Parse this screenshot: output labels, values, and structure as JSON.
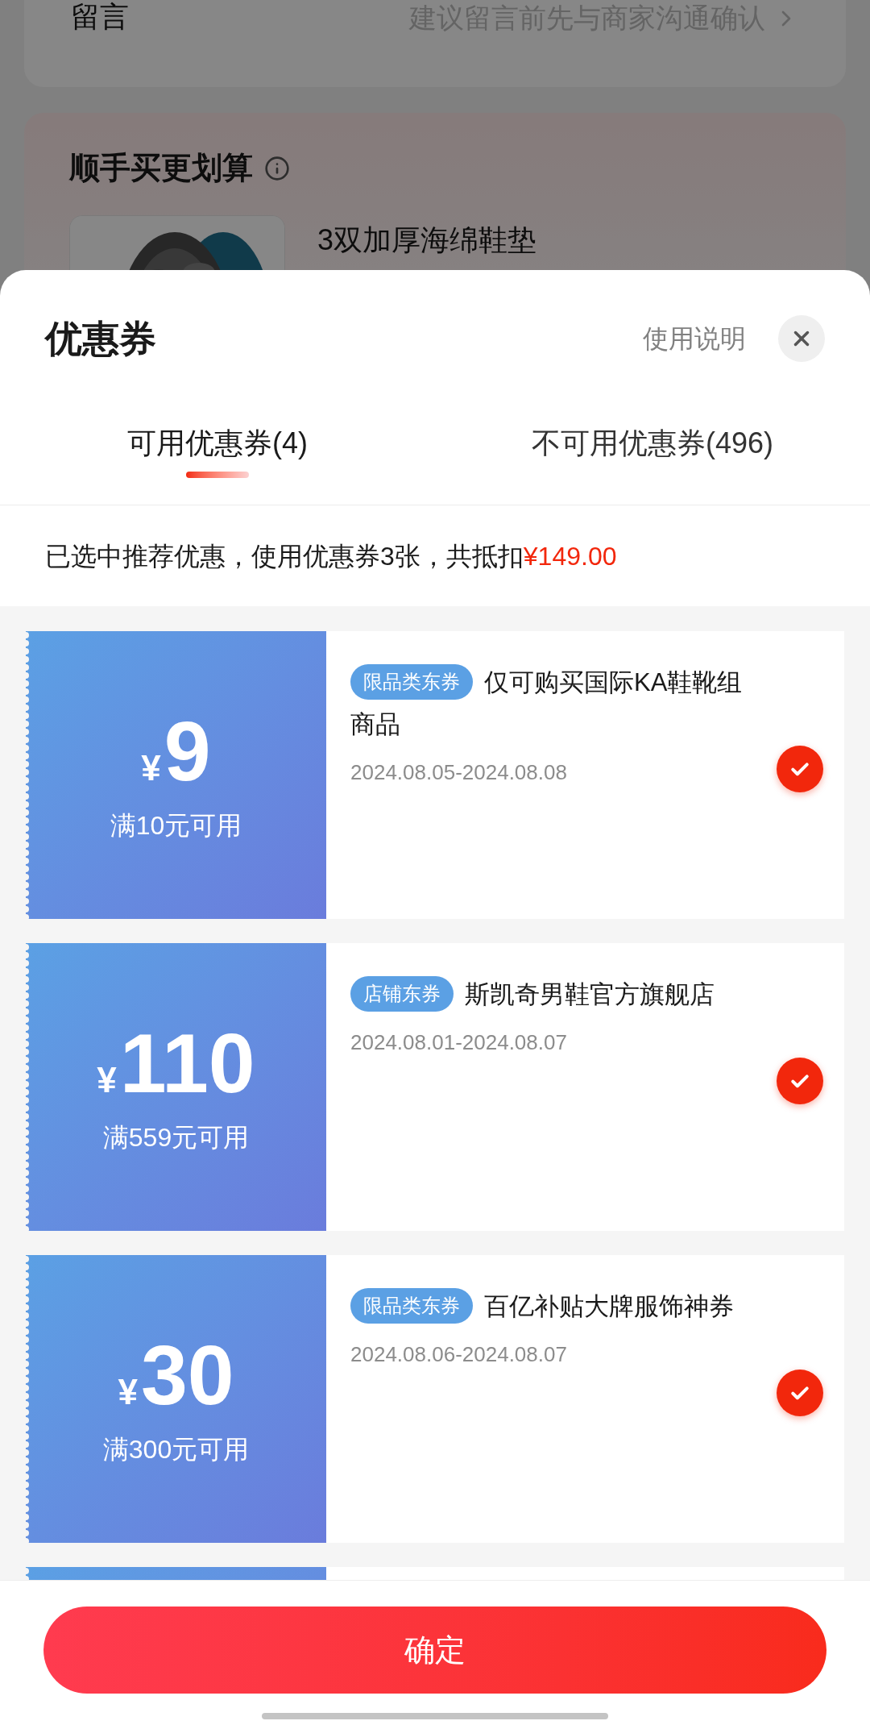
{
  "background": {
    "remark": {
      "label": "留言",
      "placeholder": "建议留言前先与商家沟通确认"
    },
    "addon": {
      "title": "顺手买更划算",
      "product": {
        "name": "3双加厚海绵鞋垫"
      }
    }
  },
  "sheet": {
    "title": "优惠券",
    "help_link": "使用说明",
    "tabs": [
      {
        "label": "可用优惠券(4)",
        "selected": true
      },
      {
        "label": "不可用优惠券(496)",
        "selected": false
      }
    ],
    "summary": "已选中推荐优惠，使用优惠券3张，共抵扣",
    "summary_amount": "¥149.00",
    "coupons": [
      {
        "currency": "¥",
        "amount": "9",
        "condition": "满10元可用",
        "tag": "限品类东券",
        "title": "仅可购买国际KA鞋靴组商品",
        "validity": "2024.08.05-2024.08.08",
        "checked": true
      },
      {
        "currency": "¥",
        "amount": "110",
        "condition": "满559元可用",
        "tag": "店铺东券",
        "title": "斯凯奇男鞋官方旗舰店",
        "validity": "2024.08.01-2024.08.07",
        "checked": true
      },
      {
        "currency": "¥",
        "amount": "30",
        "condition": "满300元可用",
        "tag": "限品类东券",
        "title": "百亿补贴大牌服饰神券",
        "validity": "2024.08.06-2024.08.07",
        "checked": true
      }
    ],
    "confirm": "确定"
  }
}
